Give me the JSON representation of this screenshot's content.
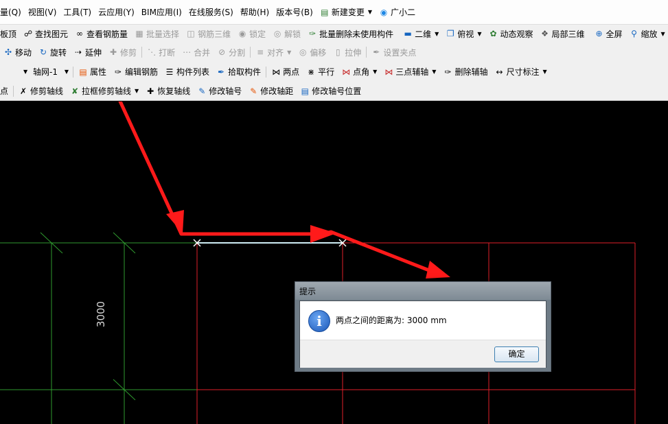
{
  "menubar": {
    "items": [
      "量(Q)",
      "视图(V)",
      "工具(T)",
      "云应用(Y)",
      "BIM应用(I)",
      "在线服务(S)",
      "帮助(H)",
      "版本号(B)",
      "新建变更",
      "广小二"
    ]
  },
  "toolbar1": {
    "items": [
      {
        "label": "板顶"
      },
      {
        "label": "查找图元"
      },
      {
        "label": "查看钢筋量"
      },
      {
        "label": "批量选择"
      },
      {
        "label": "钢筋三维"
      },
      {
        "label": "锁定"
      },
      {
        "label": "解锁"
      },
      {
        "label": "批量删除未使用构件"
      },
      {
        "label": "二维"
      },
      {
        "label": "俯视"
      },
      {
        "label": "动态观察"
      },
      {
        "label": "局部三维"
      },
      {
        "label": "全屏"
      },
      {
        "label": "缩放"
      }
    ]
  },
  "toolbar2": {
    "items": [
      {
        "label": "移动"
      },
      {
        "label": "旋转"
      },
      {
        "label": "延伸"
      },
      {
        "label": "修剪"
      },
      {
        "label": "打断"
      },
      {
        "label": "合并"
      },
      {
        "label": "分割"
      },
      {
        "label": "对齐"
      },
      {
        "label": "偏移"
      },
      {
        "label": "拉伸"
      },
      {
        "label": "设置夹点"
      }
    ]
  },
  "toolbar3": {
    "combo_value": "轴网-1",
    "items": [
      {
        "label": "属性"
      },
      {
        "label": "编辑钢筋"
      },
      {
        "label": "构件列表"
      },
      {
        "label": "拾取构件"
      },
      {
        "label": "两点"
      },
      {
        "label": "平行"
      },
      {
        "label": "点角"
      },
      {
        "label": "三点辅轴"
      },
      {
        "label": "删除辅轴"
      },
      {
        "label": "尺寸标注"
      }
    ]
  },
  "toolbar4": {
    "items": [
      {
        "label": "点"
      },
      {
        "label": "修剪轴线"
      },
      {
        "label": "拉框修剪轴线"
      },
      {
        "label": "恢复轴线"
      },
      {
        "label": "修改轴号"
      },
      {
        "label": "修改轴距"
      },
      {
        "label": "修改轴号位置"
      }
    ]
  },
  "canvas": {
    "dimension_label": "3000",
    "colors": {
      "grid_red": "#e0202a",
      "grid_green": "#2f9a2f",
      "measure_line": "#cfeef5",
      "arrow": "#ff1a1a"
    }
  },
  "dialog": {
    "title": "提示",
    "message": "两点之间的距离为: 3000 mm",
    "ok_label": "确定"
  }
}
